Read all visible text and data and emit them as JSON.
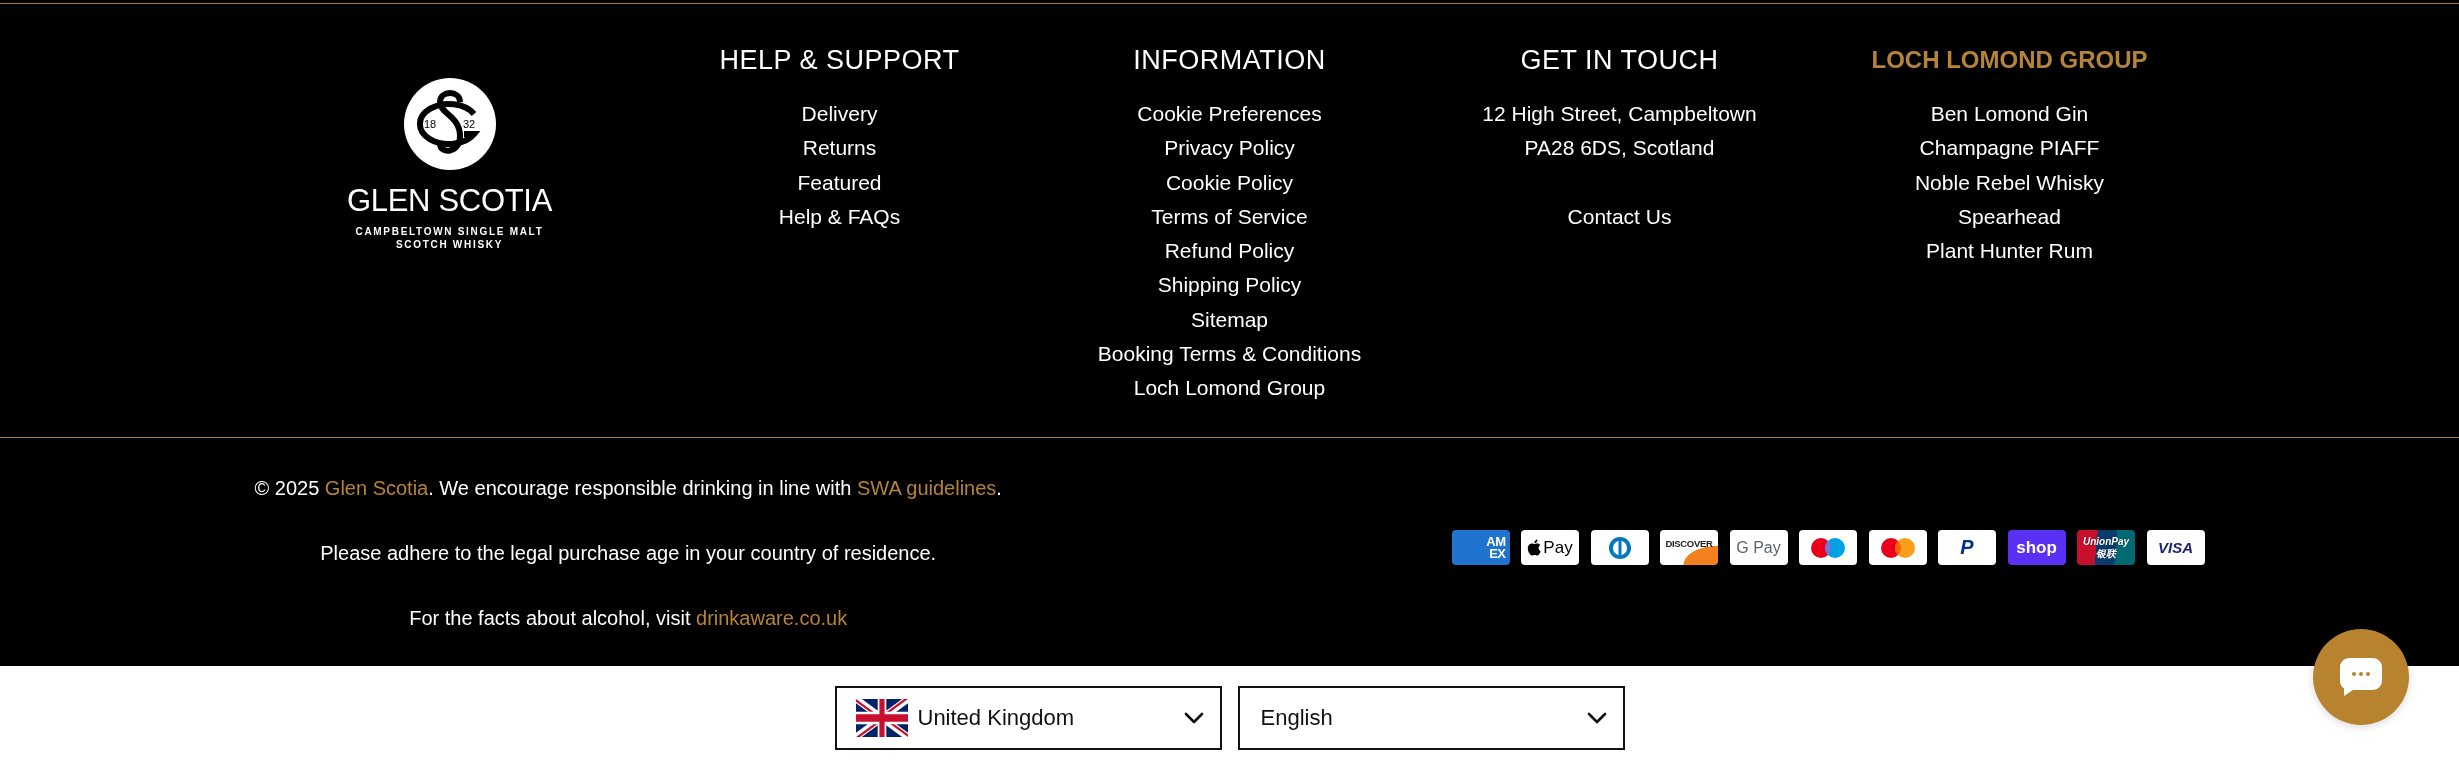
{
  "footer": {
    "logo": {
      "year": [
        "18",
        "32"
      ],
      "name": "GLEN SCOTIA",
      "tagline": [
        "CAMPBELTOWN SINGLE MALT",
        "SCOTCH WHISKY"
      ]
    },
    "columns": [
      {
        "heading": "HELP & SUPPORT",
        "accent": false,
        "links": [
          "Delivery",
          "Returns",
          "Featured",
          "Help & FAQs"
        ]
      },
      {
        "heading": "INFORMATION",
        "accent": false,
        "links": [
          "Cookie Preferences",
          "Privacy Policy",
          "Cookie Policy",
          "Terms of Service",
          "Refund Policy",
          "Shipping Policy",
          "Sitemap",
          "Booking Terms & Conditions",
          "Loch Lomond Group"
        ]
      },
      {
        "heading": "GET IN TOUCH",
        "accent": false,
        "address": [
          "12 High Street, Campbeltown",
          "PA28 6DS, Scotland"
        ],
        "links": [
          "Contact Us"
        ]
      },
      {
        "heading": "LOCH LOMOND GROUP",
        "accent": true,
        "links": [
          "Ben Lomond Gin",
          "Champagne PIAFF",
          "Noble Rebel Whisky",
          "Spearhead",
          "Plant Hunter Rum"
        ]
      }
    ],
    "notices": [
      {
        "parts": [
          {
            "kind": "text",
            "text": "© 2025 "
          },
          {
            "kind": "link",
            "text": "Glen Scotia"
          },
          {
            "kind": "text",
            "text": ". We encourage responsible drinking in line with "
          },
          {
            "kind": "link",
            "text": "SWA guidelines"
          },
          {
            "kind": "text",
            "text": "."
          }
        ]
      },
      {
        "parts": [
          {
            "kind": "text",
            "text": "Please adhere to the legal purchase age in your country of residence."
          }
        ]
      },
      {
        "parts": [
          {
            "kind": "text",
            "text": "For the facts about alcohol, visit "
          },
          {
            "kind": "link",
            "text": "drinkaware.co.uk"
          }
        ]
      }
    ],
    "payment_methods": [
      {
        "kind": "amex",
        "lines": [
          "AM",
          "EX"
        ]
      },
      {
        "kind": "applepay",
        "label": "Pay"
      },
      {
        "kind": "diners"
      },
      {
        "kind": "discover",
        "label": "DISCOVER"
      },
      {
        "kind": "gpay",
        "label": "G Pay"
      },
      {
        "kind": "maestro"
      },
      {
        "kind": "mastercard"
      },
      {
        "kind": "paypal",
        "label": "P"
      },
      {
        "kind": "shop",
        "label": "shop"
      },
      {
        "kind": "unionpay",
        "lines": [
          "UnionPay",
          "银联"
        ]
      },
      {
        "kind": "visa",
        "label": "VISA"
      }
    ]
  },
  "locale_selectors": [
    {
      "kind": "country",
      "value": "United Kingdom"
    },
    {
      "kind": "language",
      "value": "English"
    }
  ]
}
